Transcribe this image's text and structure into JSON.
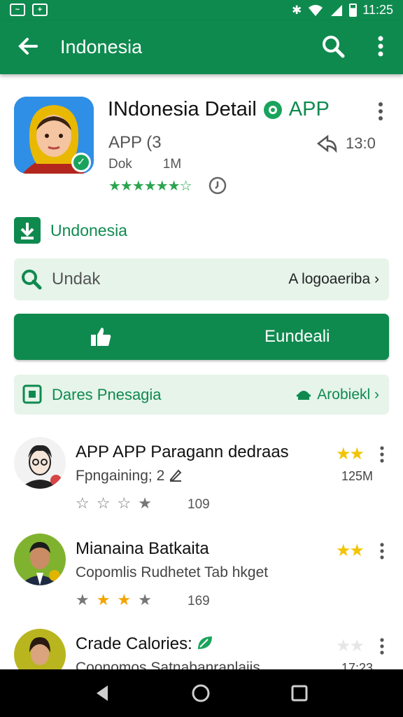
{
  "status_bar": {
    "time": "11:25",
    "icons": [
      "activity-icon",
      "battery-saver-icon",
      "bluetooth-icon",
      "wifi-icon",
      "signal-icon",
      "battery-icon"
    ]
  },
  "app_bar": {
    "title": "Indonesia",
    "icons": [
      "back-arrow-icon",
      "search-icon",
      "more-vert-icon"
    ]
  },
  "app": {
    "title": "INdonesia Detail",
    "tag": "APP",
    "developer": "APP (3",
    "right_value": "13:0",
    "meta_left": "Dok",
    "meta_right": "1M",
    "rating_stars": "★★★★★★☆"
  },
  "install": {
    "label": "Undonesia"
  },
  "search_card": {
    "label": "Undak",
    "right": "A logoaeriba"
  },
  "main_button": {
    "label": "Eundeali"
  },
  "feature_card": {
    "label": "Dares Pnesagia",
    "right": "Arobiekl"
  },
  "reviews": [
    {
      "name": "APP APP Paragann dedraas",
      "subtitle": "Fpngaining; 2",
      "side": "125M",
      "rating": 0,
      "count": "109",
      "top_stars": "★★"
    },
    {
      "name": "Mianaina Batkaita",
      "subtitle": "Copomlis Rudhetet Tab hkget",
      "side": "",
      "rating": 2,
      "count": "169",
      "top_stars": "★★"
    },
    {
      "name": "Crade Calories:",
      "subtitle": "Coonomos Satnabanranlaiis",
      "side": "17:23",
      "rating": 0,
      "count": "",
      "top_stars": "★★"
    }
  ],
  "colors": {
    "primary": "#0f8a4f",
    "card_bg": "#e6f4ea",
    "star": "#f3a400"
  }
}
